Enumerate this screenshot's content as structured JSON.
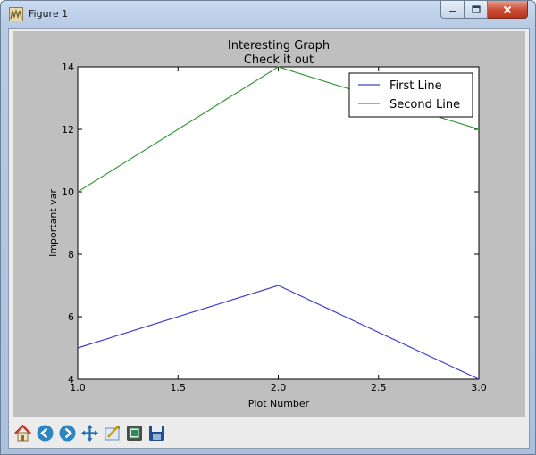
{
  "window": {
    "title": "Figure 1",
    "buttons": [
      "minimize",
      "maximize",
      "close"
    ]
  },
  "toolbar": {
    "buttons": [
      {
        "name": "home",
        "icon": "home-icon"
      },
      {
        "name": "back",
        "icon": "back-arrow-icon"
      },
      {
        "name": "forward",
        "icon": "forward-arrow-icon"
      },
      {
        "name": "pan",
        "icon": "pan-cross-icon"
      },
      {
        "name": "zoom",
        "icon": "zoom-rect-icon"
      },
      {
        "name": "configure-subplots",
        "icon": "subplots-icon"
      },
      {
        "name": "save",
        "icon": "save-disk-icon"
      }
    ]
  },
  "chart_data": {
    "type": "line",
    "title": "Interesting Graph",
    "subtitle": "Check it out",
    "xlabel": "Plot Number",
    "ylabel": "Important var",
    "xlim": [
      1.0,
      3.0
    ],
    "ylim": [
      4,
      14
    ],
    "xticks": [
      "1.0",
      "1.5",
      "2.0",
      "2.5",
      "3.0"
    ],
    "yticks": [
      "4",
      "6",
      "8",
      "10",
      "12",
      "14"
    ],
    "x": [
      1,
      2,
      3
    ],
    "series": [
      {
        "name": "First Line",
        "values": [
          5,
          7,
          4
        ],
        "color": "#4040c8"
      },
      {
        "name": "Second Line",
        "values": [
          10,
          14,
          12
        ],
        "color": "#3a9a3a"
      }
    ],
    "legend": "top-right",
    "grid": false
  }
}
